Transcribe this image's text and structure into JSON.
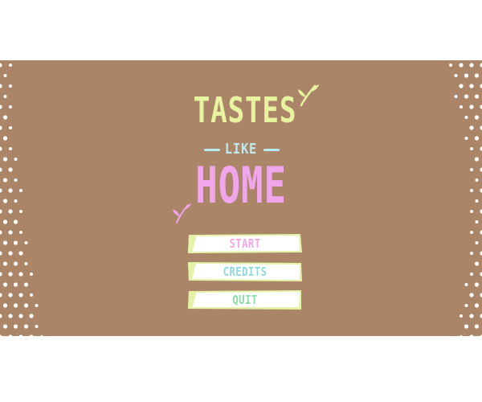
{
  "colors": {
    "background": "#ab8568",
    "dots": "#ffffff",
    "title_tastes": "#e8f3a0",
    "title_like": "#b9ecf2",
    "title_home": "#f0a6ea",
    "leaf_top": "#e8f3a0",
    "leaf_bottom": "#f0a6ea",
    "button_face": "#ffffff",
    "button_accent": "#e4f3a8",
    "label_start": "#f3a6e6",
    "label_credits": "#8fd8e0",
    "label_quit": "#8ed9a8"
  },
  "logo": {
    "line1": "TASTES",
    "line2": "LIKE",
    "line3": "HOME"
  },
  "menu": {
    "items": [
      {
        "label": "START",
        "color_key": "label_start"
      },
      {
        "label": "CREDITS",
        "color_key": "label_credits"
      },
      {
        "label": "QUIT",
        "color_key": "label_quit"
      }
    ]
  },
  "decor": {
    "left_pattern_icon": "polka-dot-pattern",
    "right_pattern_icon": "polka-dot-pattern",
    "top_leaf_icon": "leaf-icon",
    "bottom_leaf_icon": "leaf-icon"
  }
}
